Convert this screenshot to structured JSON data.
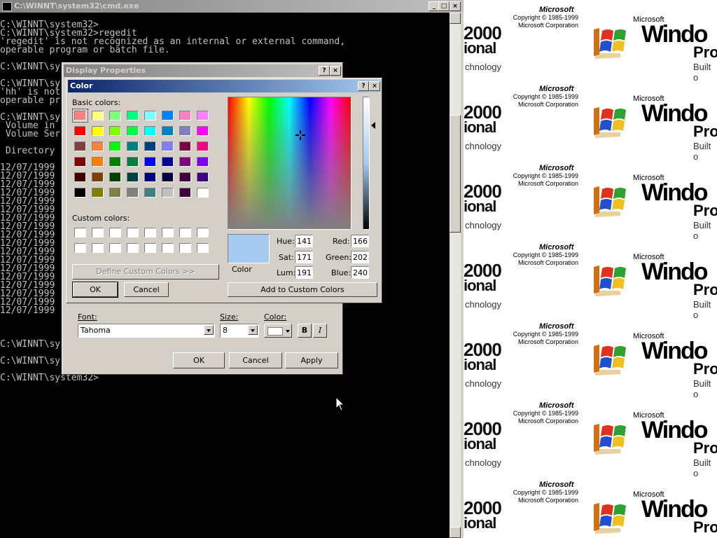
{
  "cmd": {
    "title": "C:\\WINNT\\system32\\cmd.exe",
    "lines": [
      "",
      "C:\\WINNT\\system32>",
      "C:\\WINNT\\system32>regedit",
      "'regedit' is not recognized as an internal or external command,",
      "operable program or batch file.",
      "",
      "C:\\WINNT\\sy",
      "",
      "C:\\WINNT\\sy",
      "'hh' is not",
      "operable pr",
      "",
      "C:\\WINNT\\sy",
      " Volume in",
      " Volume Ser",
      "",
      " Directory",
      "",
      "12/07/1999",
      "12/07/1999",
      "12/07/1999",
      "12/07/1999",
      "12/07/1999",
      "12/07/1999",
      "12/07/1999",
      "12/07/1999",
      "12/07/1999",
      "12/07/1999",
      "12/07/1999",
      "12/07/1999",
      "12/07/1999",
      "12/07/1999",
      "12/07/1999",
      "12/07/1999",
      "12/07/1999",
      "12/07/1999",
      "",
      "",
      "",
      "C:\\WINNT\\sy",
      "",
      "C:\\WINNT\\sy",
      "",
      "C:\\WINNT\\system32>"
    ],
    "minimize_glyph": "_",
    "maximize_glyph": "□",
    "close_glyph": "×"
  },
  "wallpaper": {
    "year": "2000",
    "edition_fragment": "ional",
    "technology_fragment": "chnology",
    "microsoft": "Microsoft",
    "copyright_line1": "Copyright © 1985-1999",
    "copyright_line2": "Microsoft Corporation",
    "ms_small": "Microsoft",
    "windows_fragment": "Windo",
    "pro_fragment": "Pro",
    "built_fragment": "Built o"
  },
  "display_properties": {
    "title": "Display Properties",
    "help_glyph": "?",
    "close_glyph": "×",
    "font_label": "Font:",
    "font_value": "Tahoma",
    "size_label": "Size:",
    "size_value": "8",
    "color_label": "Color:",
    "bold_glyph": "B",
    "italic_glyph": "I",
    "ok_label": "OK",
    "cancel_label": "Cancel",
    "apply_label": "Apply"
  },
  "color_dialog": {
    "title": "Color",
    "help_glyph": "?",
    "close_glyph": "×",
    "basic_colors_label": "Basic colors:",
    "custom_colors_label": "Custom colors:",
    "define_custom_label": "Define Custom Colors >>",
    "ok_label": "OK",
    "cancel_label": "Cancel",
    "add_custom_label": "Add to Custom Colors",
    "color_solid_label": "Color",
    "hue_label": "Hue:",
    "hue_value": "141",
    "sat_label": "Sat:",
    "sat_value": "171",
    "lum_label": "Lum:",
    "lum_value": "191",
    "red_label": "Red:",
    "red_value": "166",
    "green_label": "Green:",
    "green_value": "202",
    "blue_label": "Blue:",
    "blue_value": "240",
    "selected_color": "#a6caf0",
    "basic_colors": [
      [
        "#ff8080",
        "#ffff80",
        "#80ff80",
        "#00ff80",
        "#80ffff",
        "#0080ff",
        "#ff80c0",
        "#ff80ff"
      ],
      [
        "#ff0000",
        "#ffff00",
        "#80ff00",
        "#00ff40",
        "#00ffff",
        "#0080c0",
        "#8080c0",
        "#ff00ff"
      ],
      [
        "#804040",
        "#ff8040",
        "#00ff00",
        "#008080",
        "#004080",
        "#8080ff",
        "#800040",
        "#ff0080"
      ],
      [
        "#800000",
        "#ff8000",
        "#008000",
        "#008040",
        "#0000ff",
        "#0000a0",
        "#800080",
        "#8000ff"
      ],
      [
        "#400000",
        "#804000",
        "#004000",
        "#004040",
        "#000080",
        "#000040",
        "#400040",
        "#400080"
      ],
      [
        "#000000",
        "#808000",
        "#808040",
        "#808080",
        "#408080",
        "#c0c0c0",
        "#400040",
        "#ffffff"
      ]
    ]
  }
}
